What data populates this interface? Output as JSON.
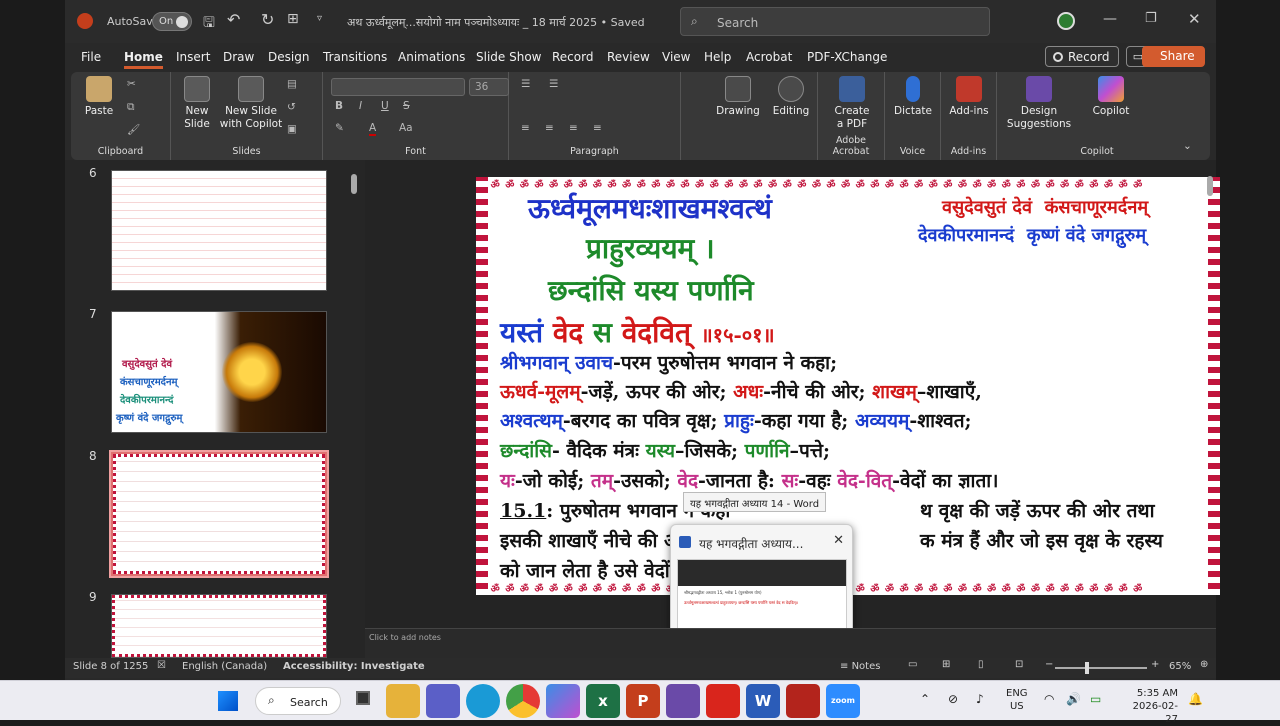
{
  "window": {
    "autosave_label": "AutoSave",
    "autosave_state": "On",
    "doc_title": "अथ ऊर्ध्वमूलम्...सयोगो नाम पञ्चमोऽध्यायः _ 18 मार्च 2025 • Saved",
    "search_placeholder": "Search"
  },
  "tabs": [
    "File",
    "Home",
    "Insert",
    "Draw",
    "Design",
    "Transitions",
    "Animations",
    "Slide Show",
    "Record",
    "Review",
    "View",
    "Help",
    "Acrobat",
    "PDF-XChange"
  ],
  "active_tab": "Home",
  "record_btn": "Record",
  "share_btn": "Share",
  "ribbon": {
    "clipboard": {
      "paste": "Paste",
      "label": "Clipboard"
    },
    "slides": {
      "new_slide": "New\nSlide",
      "new_slide_copilot": "New Slide\nwith Copilot",
      "label": "Slides"
    },
    "font": {
      "size": "36",
      "label": "Font"
    },
    "paragraph": {
      "label": "Paragraph"
    },
    "drawing": "Drawing",
    "editing": "Editing",
    "acrobat": {
      "create_pdf": "Create\na PDF",
      "label": "Adobe Acrobat"
    },
    "voice": {
      "dictate": "Dictate",
      "label": "Voice"
    },
    "addins": {
      "btn": "Add-ins",
      "label": "Add-ins"
    },
    "copilot": {
      "design": "Design\nSuggestions",
      "copilot": "Copilot",
      "label": "Copilot"
    }
  },
  "thumbs": [
    {
      "num": "6"
    },
    {
      "num": "7",
      "l1": "वसुदेवसुतं देवं",
      "l2": "कंसचाणूरमर्दनम्",
      "l3": "देवकीपरमानन्दं",
      "l4": "कृष्णं वंदे जगद्गुरुम्"
    },
    {
      "num": "8"
    },
    {
      "num": "9"
    }
  ],
  "slide": {
    "title1": "ऊर्ध्वमूलमधःशाखमश्वत्थं",
    "title2": "प्राहुरव्ययम् ।",
    "title3": "छन्दांसि यस्य पर्णानि",
    "title4a": "यस्तं",
    "title4b": "वेद",
    "title4c": "स",
    "title4d": "वेदवित्",
    "title4e": "॥१५-०१॥",
    "side1a": "वसुदेवसुतं देवं",
    "side1b": "कंसचाणूरमर्दनम्",
    "side2a": "देवकीपरमानन्दं",
    "side2b": "कृष्णं वंदे जगद्गुरुम्",
    "l5a": "श्रीभगवान् उवाच",
    "l5b": "-परम पुरुषोत्तम भगवान ने कहा;",
    "l6a": "ऊधर्व-मूलम्",
    "l6b": "-जड़ें, ऊपर की ओर;",
    "l6c": "अधः",
    "l6d": "-नीचे की ओर;",
    "l6e": "शाखम्",
    "l6f": "–शाखाएँ,",
    "l7a": "अश्वत्थम्",
    "l7b": "-बरगद का पवित्र वृक्ष;",
    "l7c": "प्राहुः",
    "l7d": "-कहा गया है;",
    "l7e": "अव्ययम्",
    "l7f": "-शाश्वत;",
    "l8a": "छन्दांसि",
    "l8b": "- वैदिक मंत्रः",
    "l8c": "यस्य",
    "l8d": "–जिसके;",
    "l8e": "पर्णानि",
    "l8f": "–पत्ते;",
    "l9a": "यः",
    "l9b": "-जो कोई;",
    "l9c": "तम्",
    "l9d": "-उसको;",
    "l9e": "वेद",
    "l9f": "-जानता है:",
    "l9g": "सः",
    "l9h": "-वहः",
    "l9i": "वेद-वित्",
    "l9j": "-वेदों का ज्ञाता।",
    "l10a": "15.1",
    "l10b": ": पुरुषोतम भगवान ने कहा",
    "l10c": "थ वृक्ष की जड़ें ऊपर की ओर तथा",
    "l11a": "इसकी शाखाएँ नीचे की ओर",
    "l11b": "क मंत्र हैं और जो इस वृक्ष के रहस्य",
    "l12a": "को जान लेता है उसे वेदों का"
  },
  "tooltip": "यह भगवद्गीता अध्याय 14 - Word",
  "preview": {
    "title": "यह भगवद्गीता अध्याय...",
    "line1": "श्रीमद्भगवद्गीता अध्याय 15, श्लोक 1 (पुरुषोत्तम योग)",
    "line2": "ऊर्ध्वमूलमधःशाखमश्वत्थं प्राहुरव्ययम्। छन्दांसि यस्य पर्णानि यस्तं वेद स वेदवित्॥"
  },
  "notes_placeholder": "Click to add notes",
  "status": {
    "slide": "Slide 8 of 1255",
    "lang": "English (Canada)",
    "access": "Accessibility: Investigate",
    "notes": "Notes",
    "zoom": "65%"
  },
  "taskbar": {
    "search": "Search",
    "lang1": "ENG",
    "lang2": "US",
    "time": "5:35 AM",
    "date": "2026-02-27"
  }
}
